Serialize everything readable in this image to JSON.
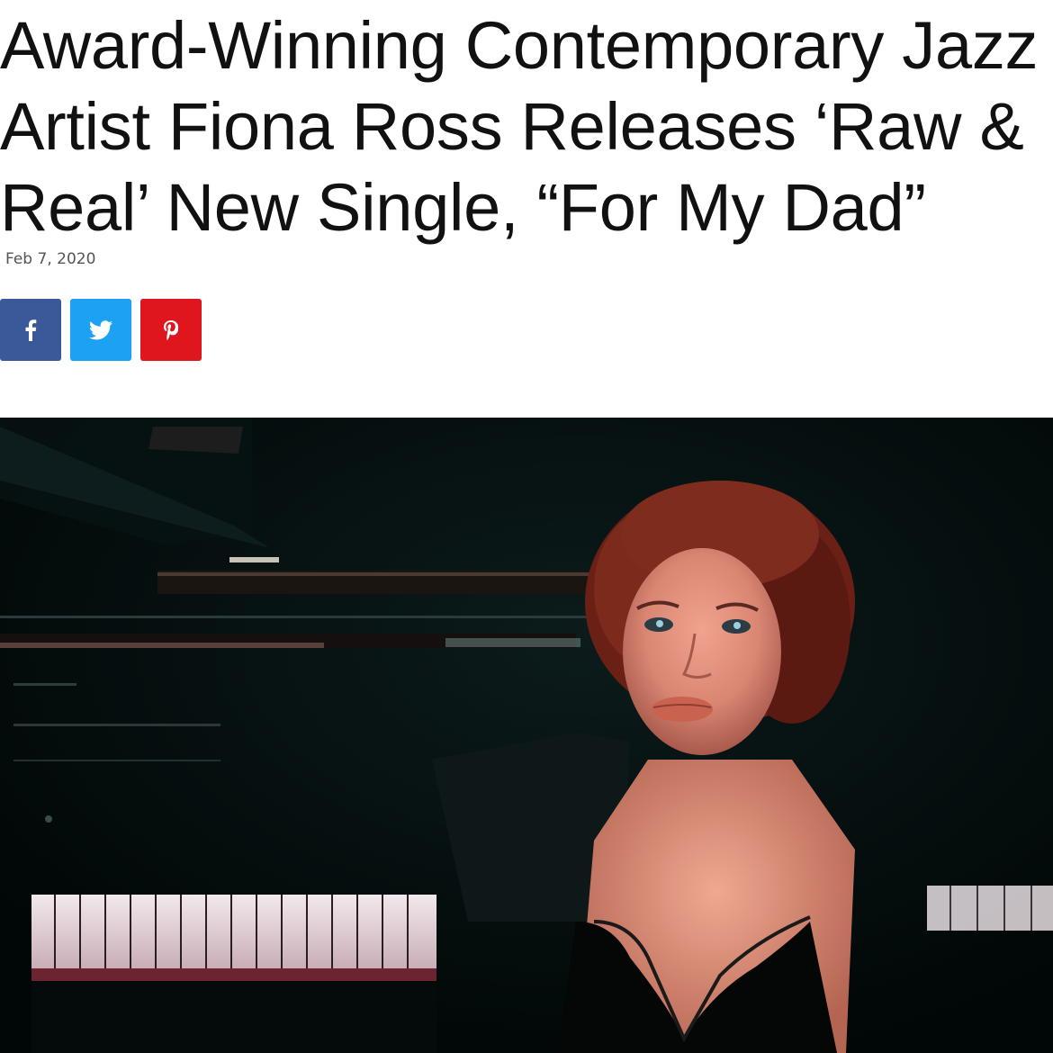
{
  "article": {
    "headline_lines": [
      "Award-Winning Contemporary Jazz",
      "Artist Fiona Ross Releases ‘Raw &",
      "Real’ New Single, “For My Dad”"
    ],
    "date": "Feb 7, 2020"
  },
  "share": {
    "buttons": [
      {
        "network": "facebook",
        "icon": "facebook-icon",
        "color": "#3b5998"
      },
      {
        "network": "twitter",
        "icon": "twitter-icon",
        "color": "#1da1f2"
      },
      {
        "network": "pinterest",
        "icon": "pinterest-icon",
        "color": "#e0161f"
      }
    ]
  },
  "hero_image": {
    "subject": "photo"
  },
  "colors": {
    "headline": "#111111",
    "date": "#555555",
    "facebook": "#3b5998",
    "twitter": "#1da1f2",
    "pinterest": "#e0161f"
  }
}
